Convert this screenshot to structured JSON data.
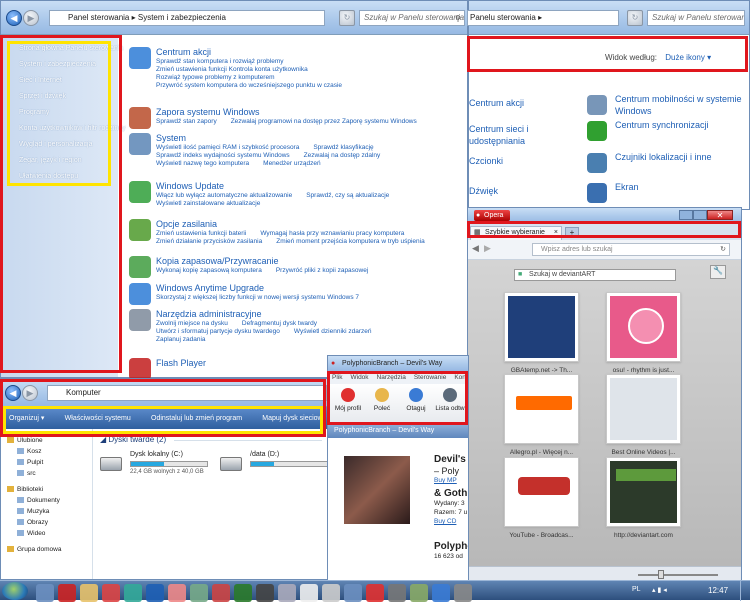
{
  "control_panel": {
    "breadcrumb": [
      "Panel sterowania",
      "System i zabezpieczenia"
    ],
    "search_placeholder": "Szukaj w Panelu sterowania",
    "sidebar": [
      "Strona główna Panelu sterowania",
      "System i zabezpieczenia",
      "Sieć i Internet",
      "Sprzęt i dźwięk",
      "Programy",
      "Konta użytkowników i filtr rodzinny",
      "Wygląd i personalizacja",
      "Zegar, język i region",
      "Ułatwienia dostępu"
    ],
    "categories": [
      {
        "title": "Centrum akcji",
        "lines": [
          [
            "Sprawdź stan komputera i rozwiąż problemy"
          ],
          [
            "Zmień ustawienia funkcji Kontrola konta użytkownika"
          ],
          [
            "Rozwiąż typowe problemy z komputerem"
          ],
          [
            "Przywróć system komputera do wcześniejszego punktu w czasie"
          ]
        ]
      },
      {
        "title": "Zapora systemu Windows",
        "lines": [
          [
            "Sprawdź stan zapory",
            "Zezwalaj programowi na dostęp przez Zaporę systemu Windows"
          ]
        ]
      },
      {
        "title": "System",
        "lines": [
          [
            "Wyświetl ilość pamięci RAM i szybkość procesora",
            "Sprawdź klasyfikację"
          ],
          [
            "Sprawdź indeks wydajności systemu Windows",
            "Zezwalaj na dostęp zdalny"
          ],
          [
            "Wyświetl nazwę tego komputera",
            "Menedżer urządzeń"
          ]
        ]
      },
      {
        "title": "Windows Update",
        "lines": [
          [
            "Włącz lub wyłącz automatyczne aktualizowanie",
            "Sprawdź, czy są aktualizacje"
          ],
          [
            "Wyświetl zainstalowane aktualizacje"
          ]
        ]
      },
      {
        "title": "Opcje zasilania",
        "lines": [
          [
            "Zmień ustawienia funkcji baterii",
            "Wymagaj hasła przy wznawianiu pracy komputera"
          ],
          [
            "Zmień działanie przycisków zasilania",
            "Zmień moment przejścia komputera w tryb uśpienia"
          ]
        ]
      },
      {
        "title": "Kopia zapasowa/Przywracanie",
        "lines": [
          [
            "Wykonaj kopię zapasową komputera",
            "Przywróć pliki z kopii zapasowej"
          ]
        ]
      },
      {
        "title": "Windows Anytime Upgrade",
        "lines": [
          [
            "Skorzystaj z większej liczby funkcji w nowej wersji systemu Windows 7"
          ]
        ]
      },
      {
        "title": "Narzędzia administracyjne",
        "lines": [
          [
            "Zwolnij miejsce na dysku",
            "Defragmentuj dysk twardy"
          ],
          [
            "Utwórz i sformatuj partycje dysku twardego",
            "Wyświetl dzienniki zdarzeń"
          ],
          [
            "Zaplanuj zadania"
          ]
        ]
      },
      {
        "title": "Flash Player",
        "lines": []
      }
    ]
  },
  "all_items": {
    "breadcrumb": "Panelu sterowania",
    "search_placeholder": "Szukaj w Panelu sterowania",
    "view_label": "Widok według:",
    "view_value": "Duże ikony",
    "items_left": [
      "Centrum akcji",
      "Centrum sieci i udostępniania",
      "Czcionki",
      "Dźwięk"
    ],
    "items_right": [
      "Centrum mobilności w systemie Windows",
      "Centrum synchronizacji",
      "Czujniki lokalizacji i inne",
      "Ekran"
    ]
  },
  "opera": {
    "menu_label": "Opera",
    "tab_label": "Szybkie wybieranie",
    "address_placeholder": "Wpisz adres lub szukaj",
    "search_placeholder": "Szukaj w deviantART",
    "dials": [
      {
        "caption": "GBAtemp.net -> Th..."
      },
      {
        "caption": "osu! - rhythm is just..."
      },
      {
        "caption": "Allegro.pl - Więcej n..."
      },
      {
        "caption": "Best Online Videos |..."
      },
      {
        "caption": "YouTube - Broadcas..."
      },
      {
        "caption": "http://deviantart.com"
      }
    ]
  },
  "explorer": {
    "breadcrumb": "Komputer",
    "toolbar": [
      "Organizuj ▾",
      "Właściwości systemu",
      "Odinstaluj lub zmień program",
      "Mapuj dysk sieciowy"
    ],
    "nav_tree": [
      {
        "label": "Ulubione",
        "level": 0
      },
      {
        "label": "Kosz",
        "level": 1
      },
      {
        "label": "Pulpit",
        "level": 1
      },
      {
        "label": "src",
        "level": 1
      },
      {
        "label": "Biblioteki",
        "level": 0
      },
      {
        "label": "Dokumenty",
        "level": 1
      },
      {
        "label": "Muzyka",
        "level": 1
      },
      {
        "label": "Obrazy",
        "level": 1
      },
      {
        "label": "Wideo",
        "level": 1
      },
      {
        "label": "Grupa domowa",
        "level": 0
      }
    ],
    "group_header": "Dyski twarde (2)",
    "drives": [
      {
        "name": "Dysk lokalny (C:)",
        "free": "22,4 GB wolnych z 40,0 GB",
        "used_fraction": 0.44
      },
      {
        "name": "/data (D:)",
        "free": "",
        "used_fraction": 0.3
      }
    ]
  },
  "itunes": {
    "title": "PolyphonicBranch – Devil's Way",
    "menu": [
      "Plik",
      "Widok",
      "Narzędzia",
      "Sterowanie",
      "Kon"
    ],
    "toolbar": [
      "Mój profil",
      "Poleć",
      "Otaguj",
      "Lista odtw"
    ],
    "header": "PolyphonicBranch – Devil's Way",
    "albums": [
      {
        "title": "Devil's",
        "sub": "– Poly",
        "link": "Buy MP"
      },
      {
        "title": "& Gothi",
        "sub": "Wydany: 3",
        "extra": "Razem: 7 u",
        "link": "Buy CD"
      },
      {
        "title": "Polypho",
        "sub": "16 623 od"
      }
    ]
  },
  "taskbar": {
    "lang": "PL",
    "time": "12:47"
  }
}
